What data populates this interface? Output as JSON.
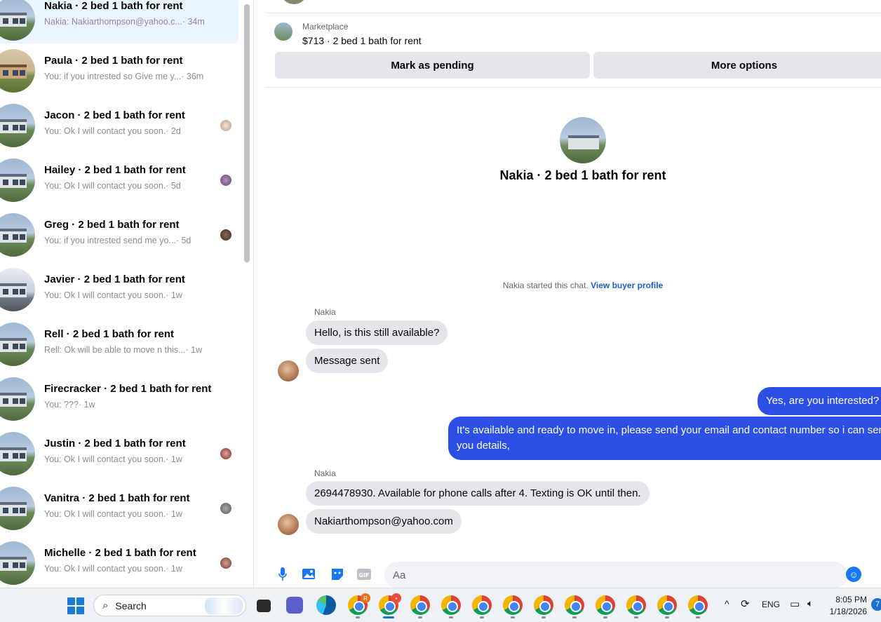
{
  "sidebar": {
    "conversations": [
      {
        "title": "Nakia · 2 bed 1 bath for rent",
        "preview": "Nakia: Nakiarthompson@yahoo.c...",
        "time": "· 34m",
        "active": true
      },
      {
        "title": "Paula · 2 bed 1 bath for rent",
        "preview": "You: if you intrested so Give me y...",
        "time": "· 36m"
      },
      {
        "title": "Jacon · 2 bed 1 bath for rent",
        "preview": "You: Ok I will contact you soon.",
        "time": "· 2d"
      },
      {
        "title": "Hailey · 2 bed 1 bath for rent",
        "preview": "You: Ok I will contact you soon.",
        "time": "· 5d"
      },
      {
        "title": "Greg · 2 bed 1 bath for rent",
        "preview": "You: if you intrested send me yo...",
        "time": "· 5d"
      },
      {
        "title": "Javier · 2 bed 1 bath for rent",
        "preview": "You: Ok I will contact you soon.",
        "time": "· 1w"
      },
      {
        "title": "Rell · 2 bed 1 bath for rent",
        "preview": "Rell: Ok will be able to move n this...",
        "time": "· 1w"
      },
      {
        "title": "Firecracker · 2 bed 1 bath for rent",
        "preview": "You: ???",
        "time": "· 1w"
      },
      {
        "title": "Justin · 2 bed 1 bath for rent",
        "preview": "You: Ok I will contact you soon.",
        "time": "· 1w"
      },
      {
        "title": "Vanitra · 2 bed 1 bath for rent",
        "preview": "You: Ok I will contact you soon.",
        "time": "· 1w"
      },
      {
        "title": "Michelle · 2 bed 1 bath for rent",
        "preview": "You: Ok I will contact you soon.",
        "time": "· 1w"
      }
    ]
  },
  "chat": {
    "marketplace_label": "Marketplace",
    "listing": "$713 · 2 bed 1 bath for rent",
    "mark_pending": "Mark as pending",
    "more_options": "More options",
    "conversation_title": "Nakia · 2 bed 1 bath for rent",
    "started_text": "Nakia started this chat.",
    "view_profile": "View buyer profile",
    "sender_name": "Nakia",
    "messages": {
      "m1": "Hello, is this still available?",
      "m2": "Message sent",
      "m3": "Yes, are you interested?",
      "m4": "It's available and ready to move in, please send your email and contact number so i can send you details,",
      "m5": "2694478930. Available for phone calls after 4. Texting is OK until then.",
      "m6": "Nakiarthompson@yahoo.com"
    },
    "composer_placeholder": "Aa"
  },
  "taskbar": {
    "search_label": "Search",
    "lang": "ENG",
    "time": "8:05 PM",
    "date": "1/18/2026",
    "notifications": "7"
  },
  "colors": {
    "accent": "#2d4fe6",
    "link": "#1a5fc9",
    "bubble_in": "#e4e6eb",
    "active_row": "#ebf5ff"
  }
}
